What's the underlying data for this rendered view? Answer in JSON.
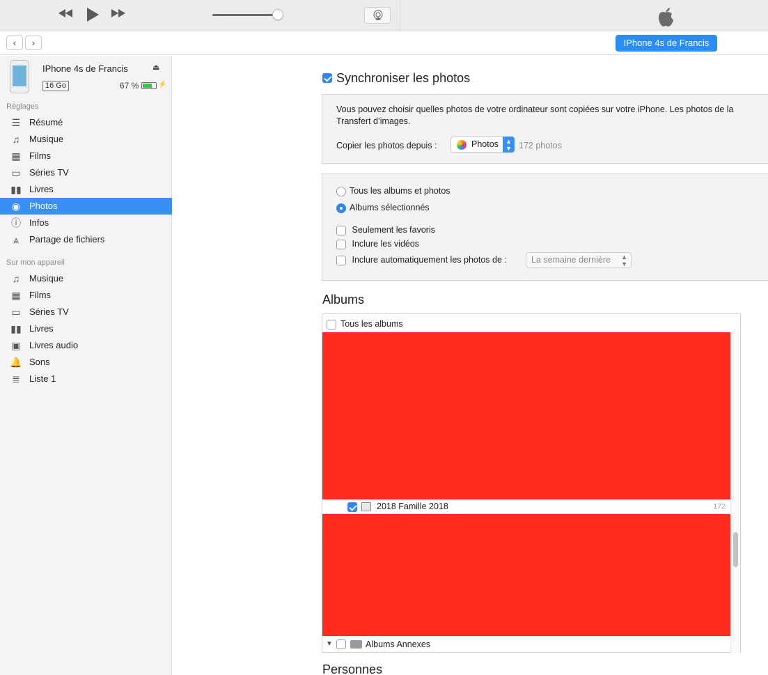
{
  "toolbar": {
    "rewind_icon": "rewind-icon",
    "play_icon": "play-icon",
    "forward_icon": "fast-forward-icon",
    "airplay_icon": "airplay-icon",
    "logo_icon": "apple-logo-icon"
  },
  "nav": {
    "back": "‹",
    "forward": "›",
    "device_button": "IPhone 4s de Francis"
  },
  "device": {
    "name": "IPhone 4s de Francis",
    "capacity": "16 Go",
    "battery": "67 %",
    "battery_level": 0.67,
    "battery_color": "#3cc24a",
    "eject": "⏏",
    "charging": "⚡"
  },
  "sidebar": {
    "settings_header": "Réglages",
    "settings_items": [
      {
        "label": "Résumé",
        "icon": "summary-icon",
        "glyph": "☰"
      },
      {
        "label": "Musique",
        "icon": "music-icon",
        "glyph": "♫"
      },
      {
        "label": "Films",
        "icon": "film-icon",
        "glyph": "▦"
      },
      {
        "label": "Séries TV",
        "icon": "tv-icon",
        "glyph": "▭"
      },
      {
        "label": "Livres",
        "icon": "book-icon",
        "glyph": "▮▮"
      },
      {
        "label": "Photos",
        "icon": "camera-icon",
        "glyph": "◉",
        "active": true
      },
      {
        "label": "Infos",
        "icon": "info-icon",
        "glyph": "ⓘ"
      },
      {
        "label": "Partage de fichiers",
        "icon": "app-store-icon",
        "glyph": "⩓"
      }
    ],
    "device_header": "Sur mon appareil",
    "device_items": [
      {
        "label": "Musique",
        "icon": "music-icon",
        "glyph": "♫"
      },
      {
        "label": "Films",
        "icon": "film-icon",
        "glyph": "▦"
      },
      {
        "label": "Séries TV",
        "icon": "tv-icon",
        "glyph": "▭"
      },
      {
        "label": "Livres",
        "icon": "book-icon",
        "glyph": "▮▮"
      },
      {
        "label": "Livres audio",
        "icon": "audiobook-icon",
        "glyph": "▣"
      },
      {
        "label": "Sons",
        "icon": "bell-icon",
        "glyph": "🔔"
      },
      {
        "label": "Liste 1",
        "icon": "playlist-icon",
        "glyph": "≣"
      }
    ],
    "accent": "#3a8ff5"
  },
  "main": {
    "sync_label": "Synchroniser les photos",
    "sync_checked": true,
    "description_line1": "Vous pouvez choisir quelles photos de votre ordinateur sont copiées sur votre iPhone. Les photos de la",
    "description_line2": "Transfert d’images.",
    "copy_from_label": "Copier les photos depuis :",
    "copy_from_value": "Photos",
    "photo_count": "172 photos",
    "radio_all": "Tous les albums et photos",
    "radio_selected": "Albums sélectionnés",
    "radio_selected_checked": true,
    "opt_favorites": "Seulement les favoris",
    "opt_videos": "Inclure les vidéos",
    "opt_auto": "Inclure automatiquement les photos de :",
    "auto_period": "La semaine dernière",
    "albums_title": "Albums",
    "all_albums": "Tous les albums",
    "album_name": "2018 Famille 2018",
    "album_count": "172",
    "album_checked": true,
    "annex_name": "Albums Annexes",
    "persons_title": "Personnes",
    "redaction_color": "#ff2b1f"
  }
}
